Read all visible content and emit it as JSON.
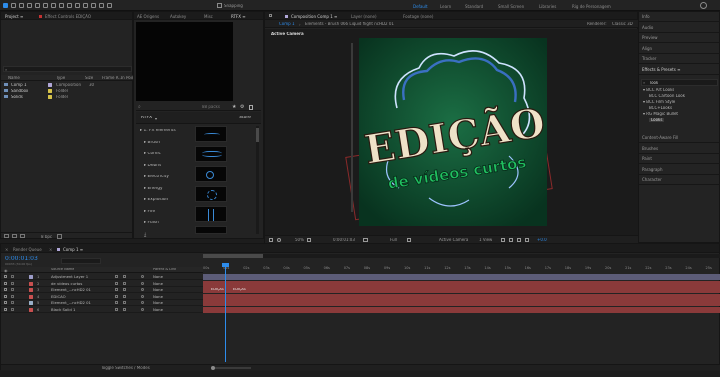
{
  "toolbar": {
    "snapping_label": "Snapping",
    "workspaces": [
      {
        "label": "Default",
        "active": true
      },
      {
        "label": "Learn"
      },
      {
        "label": "Standard"
      },
      {
        "label": "Small Screen"
      },
      {
        "label": "Libraries"
      },
      {
        "label": "Rig de Personagem"
      }
    ]
  },
  "project": {
    "tabs": [
      "Project ≡",
      "Effect Controls EDIÇÃO"
    ],
    "search_placeholder": "",
    "columns": [
      "Name",
      "Type",
      "Size",
      "Frame R...",
      "In Point"
    ],
    "items": [
      {
        "name": "Comp 1",
        "type": "Composition",
        "size": "",
        "frame_rate": "30",
        "color": "#b0a7d8"
      },
      {
        "name": "Sandbox",
        "type": "Folder",
        "size": "",
        "frame_rate": "",
        "color": "#d6c34a"
      },
      {
        "name": "Solids",
        "type": "Folder",
        "size": "",
        "frame_rate": "",
        "color": "#d6c34a"
      }
    ],
    "footer_bpc": "8 bpc"
  },
  "middle_panel": {
    "tabs": [
      "AE Origens",
      "Autokey",
      "Misc",
      "RTFX ≡"
    ]
  },
  "rtfx": {
    "search_placeholder": "",
    "count_text": "88 packs",
    "title": "RTFX",
    "store_label": "Store",
    "categories": [
      "1. FX elements",
      "Brush",
      "Comic",
      "Debris",
      "Electricity",
      "Energy",
      "Explosion",
      "Fire",
      "Flash"
    ]
  },
  "viewer": {
    "tabs": [
      "Composition Comp 1 ≡",
      "Layer (none)",
      "Footage (none)"
    ],
    "sub_tab": "Comp 1",
    "breadcrumb": "Elements - Brush 066 Liquid flight ncHD2 01",
    "renderer_label": "Renderer:",
    "renderer_value": "Classic 3D",
    "active_camera_label": "Active Camera",
    "footer": {
      "zoom": "50%",
      "timecode": "0:00:01:03",
      "resolution": "Full",
      "camera": "Active Camera",
      "view": "1 View",
      "exposure": "+0.0"
    }
  },
  "artwork": {
    "title_text": "EDIÇÃO",
    "subtitle_text": "de vídeos curtos",
    "bg_color": "#0d4a2e",
    "accent_color": "#20c060"
  },
  "right_panel": {
    "items": [
      "Info",
      "Audio",
      "Preview",
      "Align",
      "Tracker",
      "Effects & Presets ≡"
    ],
    "search_value": "look",
    "presets": [
      {
        "label": "BCC Art Looks",
        "indent": 0
      },
      {
        "label": "BCC Cartoon Look",
        "indent": 1
      },
      {
        "label": "BCC Film Style",
        "indent": 0
      },
      {
        "label": "BCC+Looks",
        "indent": 1
      },
      {
        "label": "RG Magic Bullet",
        "indent": 0
      },
      {
        "label": "Looks",
        "indent": 1,
        "selected": true
      }
    ],
    "lower_items": [
      "Content-Aware Fill",
      "Brushes",
      "Paint",
      "Paragraph",
      "Character"
    ]
  },
  "timeline": {
    "tabs": [
      "Render Queue",
      "Comp 1 ≡"
    ],
    "timecode": "0:00:01:03",
    "timecode_sub": "00033 (30.00 fps)",
    "col_source": "Source Name",
    "col_parent": "Parent & Link",
    "ticks": [
      "00s",
      "01s",
      "02s",
      "03s",
      "04s",
      "05s",
      "06s",
      "07s",
      "08s",
      "09s",
      "10s",
      "11s",
      "12s",
      "13s",
      "14s",
      "15s",
      "16s",
      "17s",
      "18s",
      "19s",
      "20s",
      "21s",
      "22s",
      "23s",
      "24s",
      "25s"
    ],
    "layers": [
      {
        "num": "1",
        "name": "Adjustment Layer 1",
        "color": "#9c9cc8",
        "parent": "None"
      },
      {
        "num": "2",
        "name": "de vídeos curtos",
        "color": "#c85050",
        "parent": "None"
      },
      {
        "num": "3",
        "name": "Element_...ncHD2 01",
        "color": "#c85050",
        "parent": "None"
      },
      {
        "num": "4",
        "name": "EDIÇÃO",
        "color": "#c85050",
        "parent": "None"
      },
      {
        "num": "5",
        "name": "Element_...ncHD2 01",
        "color": "#9ab0c8",
        "parent": "None"
      },
      {
        "num": "6",
        "name": "Black Solid 1",
        "color": "#c85050",
        "parent": "None"
      }
    ],
    "clip_label_a": "EDIÇÃO",
    "clip_label_b": "EDIÇÃO",
    "footer_label": "Toggle Switches / Modes"
  },
  "colors": {
    "accent": "#2d8ceb",
    "playhead": "#2d8ceb",
    "layer_bar": "#8a3a3a",
    "adj_bar": "#5c5c78"
  }
}
